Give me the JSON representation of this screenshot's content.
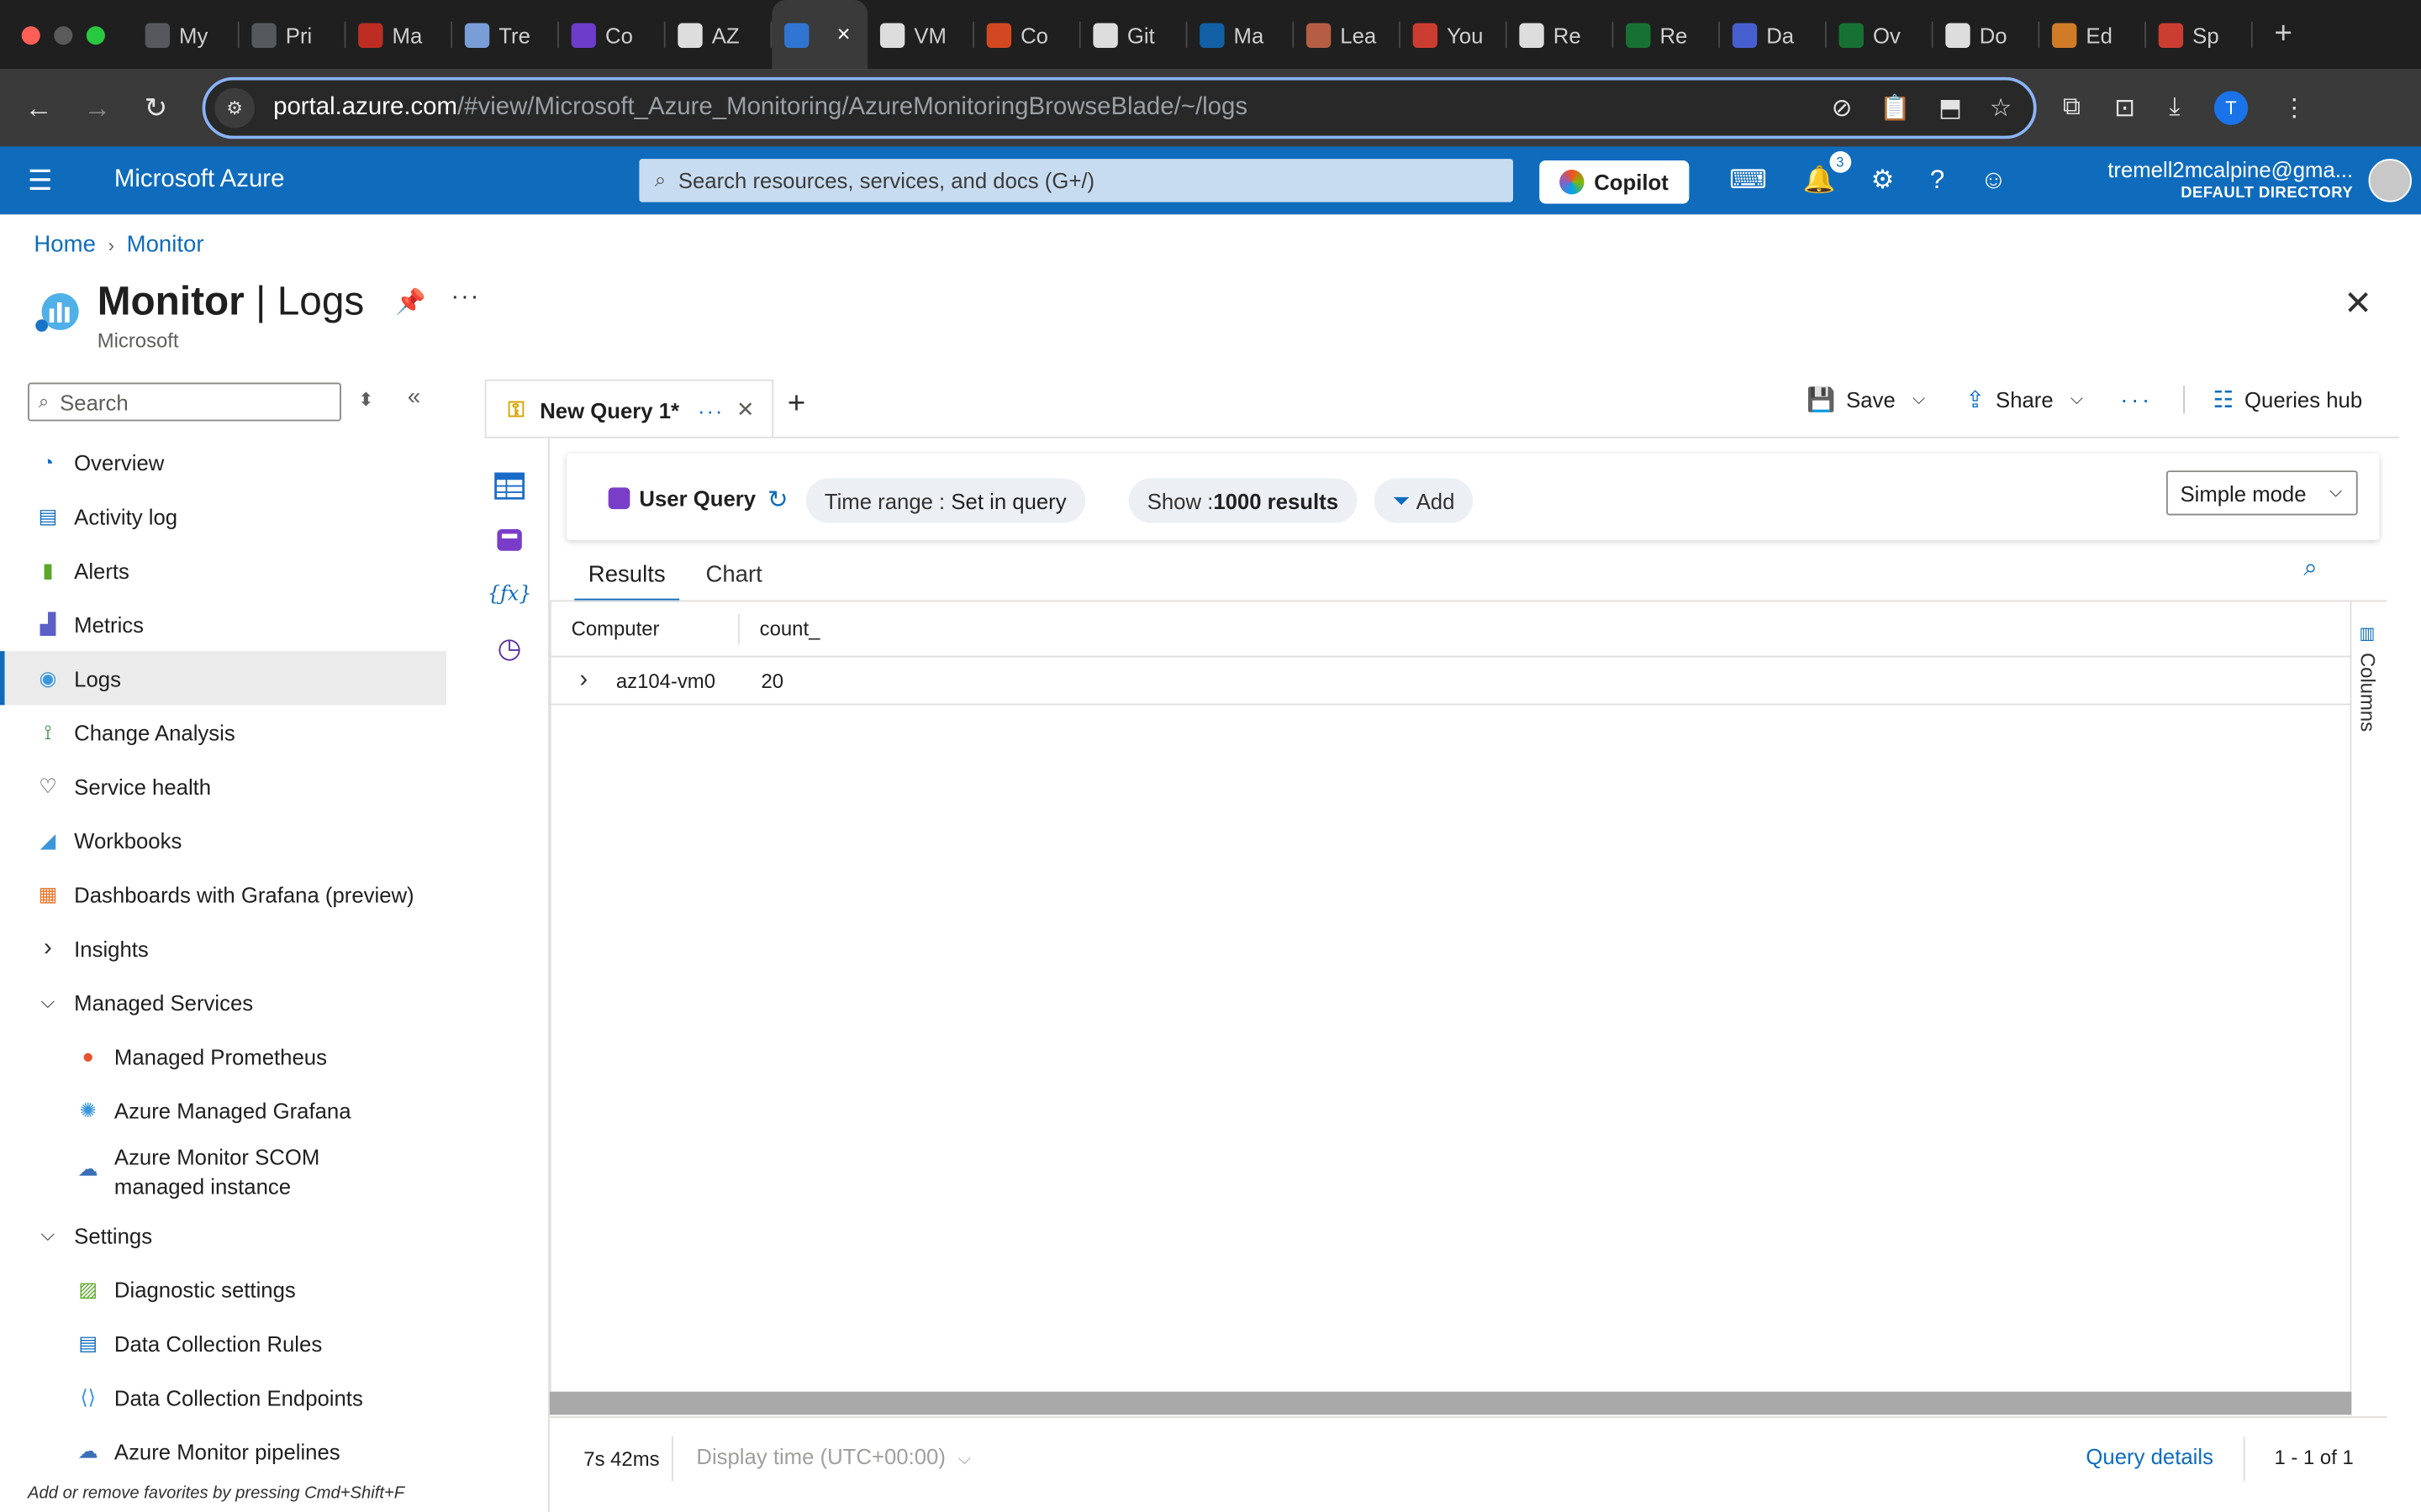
{
  "browser": {
    "tabs": [
      {
        "label": "My",
        "icon": "doc-icon",
        "color": "#5f6368"
      },
      {
        "label": "Pri",
        "icon": "doc-icon",
        "color": "#5f6368"
      },
      {
        "label": "Ma",
        "icon": "kubernetes-icon",
        "color": "#d93025"
      },
      {
        "label": "Tre",
        "icon": "globe-icon",
        "color": "#8ab4f8"
      },
      {
        "label": "Co",
        "icon": "u-icon",
        "color": "#7b42e8"
      },
      {
        "label": "AZ",
        "icon": "github-icon",
        "color": "#ffffff"
      },
      {
        "label": "",
        "icon": "azure-icon",
        "color": "#2f80ed",
        "active": true
      },
      {
        "label": "VM",
        "icon": "openai-icon",
        "color": "#ffffff"
      },
      {
        "label": "Co",
        "icon": "microsoft-icon",
        "color": "#f25022"
      },
      {
        "label": "Git",
        "icon": "github-icon",
        "color": "#ffffff"
      },
      {
        "label": "Ma",
        "icon": "outlook-icon",
        "color": "#0f6cbd"
      },
      {
        "label": "Lea",
        "icon": "avatar-icon",
        "color": "#d06a4a"
      },
      {
        "label": "You",
        "icon": "gmail-icon",
        "color": "#ea4335"
      },
      {
        "label": "Re",
        "icon": "pen-icon",
        "color": "#ffffff"
      },
      {
        "label": "Re",
        "icon": "gm-icon",
        "color": "#188038"
      },
      {
        "label": "Da",
        "icon": "d-icon",
        "color": "#4f6bed"
      },
      {
        "label": "Ov",
        "icon": "gm-icon",
        "color": "#188038"
      },
      {
        "label": "Do",
        "icon": "download-icon",
        "color": "#ffffff"
      },
      {
        "label": "Ed",
        "icon": "fox-icon",
        "color": "#f28c28"
      },
      {
        "label": "Sp",
        "icon": "gmail-icon",
        "color": "#ea4335"
      }
    ],
    "active_close": "×",
    "new_tab": "+",
    "url_domain": "portal.azure.com",
    "url_path": "/#view/Microsoft_Azure_Monitoring/AzureMonitoringBrowseBlade/~/logs",
    "profile_initial": "T"
  },
  "azure": {
    "brand": "Microsoft Azure",
    "search_placeholder": "Search resources, services, and docs (G+/)",
    "copilot_label": "Copilot",
    "notification_count": "3",
    "user_email": "tremell2mcalpine@gma...",
    "user_directory": "DEFAULT DIRECTORY"
  },
  "breadcrumb": {
    "home": "Home",
    "monitor": "Monitor"
  },
  "page": {
    "title_main": "Monitor",
    "title_sep": " | ",
    "title_section": "Logs",
    "subtitle": "Microsoft"
  },
  "nav": {
    "search_placeholder": "Search",
    "items": [
      {
        "label": "Overview",
        "icon": "gauge-icon"
      },
      {
        "label": "Activity log",
        "icon": "activity-log-icon"
      },
      {
        "label": "Alerts",
        "icon": "alert-icon"
      },
      {
        "label": "Metrics",
        "icon": "metrics-icon"
      },
      {
        "label": "Logs",
        "icon": "logs-icon",
        "active": true
      },
      {
        "label": "Change Analysis",
        "icon": "change-analysis-icon"
      },
      {
        "label": "Service health",
        "icon": "heart-icon"
      },
      {
        "label": "Workbooks",
        "icon": "workbook-icon"
      },
      {
        "label": "Dashboards with Grafana (preview)",
        "icon": "grafana-dashboard-icon"
      },
      {
        "label": "Insights",
        "group": true,
        "expanded": false
      },
      {
        "label": "Managed Services",
        "group": true,
        "expanded": true
      },
      {
        "label": "Managed Prometheus",
        "icon": "prometheus-icon",
        "child": true
      },
      {
        "label": "Azure Managed Grafana",
        "icon": "grafana-icon",
        "child": true
      },
      {
        "label": "Azure Monitor SCOM managed instance",
        "icon": "scom-icon",
        "child": true
      },
      {
        "label": "Settings",
        "group": true,
        "expanded": true
      },
      {
        "label": "Diagnostic settings",
        "icon": "diagnostic-icon",
        "child": true
      },
      {
        "label": "Data Collection Rules",
        "icon": "dcr-icon",
        "child": true
      },
      {
        "label": "Data Collection Endpoints",
        "icon": "dce-icon",
        "child": true
      },
      {
        "label": "Azure Monitor pipelines",
        "icon": "pipeline-icon",
        "child": true
      }
    ],
    "footer": "Add or remove favorites by pressing Cmd+Shift+F"
  },
  "query": {
    "tab_label": "New Query 1*",
    "toolbar": {
      "save": "Save",
      "share": "Share",
      "queries_hub": "Queries hub"
    },
    "user_query": "User Query",
    "time_range_label": "Time range : ",
    "time_range_value": "Set in query",
    "show_label": "Show : ",
    "show_value": "1000 results",
    "add_label": "Add",
    "mode": "Simple mode"
  },
  "results": {
    "tabs": [
      "Results",
      "Chart"
    ],
    "columns": [
      "Computer",
      "count_"
    ],
    "rows": [
      {
        "Computer": "az104-vm0",
        "count_": "20"
      }
    ],
    "columns_rail_label": "Columns",
    "elapsed": "7s 42ms",
    "display_time": "Display time (UTC+00:00)",
    "query_details": "Query details",
    "row_count": "1 - 1 of 1"
  }
}
